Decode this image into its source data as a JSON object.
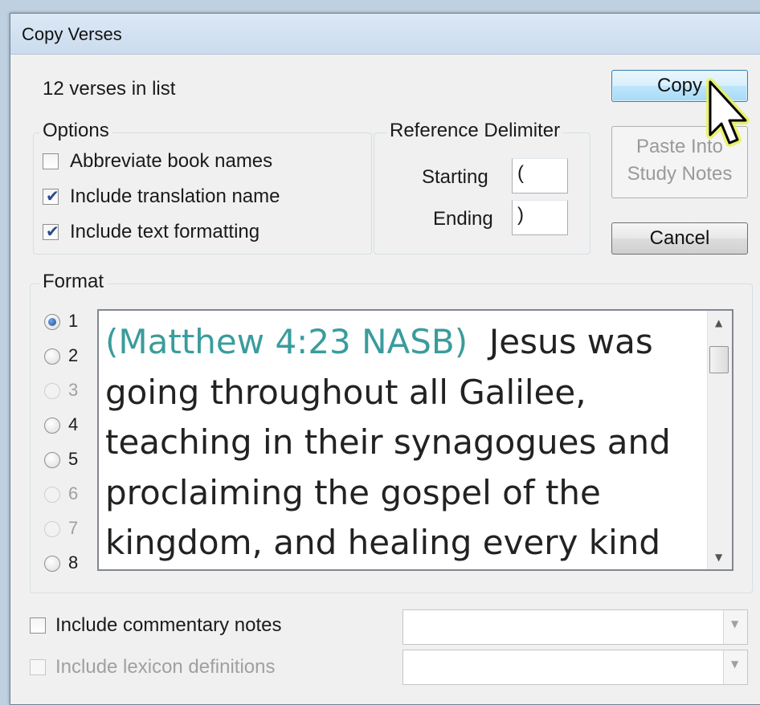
{
  "window": {
    "title": "Copy Verses"
  },
  "summary": "12 verses in list",
  "options": {
    "title": "Options",
    "abbreviate": {
      "label": "Abbreviate book names",
      "checked": false
    },
    "translation": {
      "label": "Include translation name",
      "checked": true
    },
    "formatting": {
      "label": "Include text formatting",
      "checked": true
    }
  },
  "delimiter": {
    "title": "Reference Delimiter",
    "starting_label": "Starting",
    "starting_value": "(",
    "ending_label": "Ending",
    "ending_value": ")"
  },
  "buttons": {
    "copy": "Copy",
    "paste_line1": "Paste Into",
    "paste_line2": "Study Notes",
    "cancel": "Cancel"
  },
  "format": {
    "title": "Format",
    "selected": "1",
    "options": [
      "1",
      "2",
      "3",
      "4",
      "5",
      "6",
      "7",
      "8"
    ],
    "disabled": [
      "3",
      "6",
      "7"
    ]
  },
  "preview": {
    "reference": "(Matthew 4:23 NASB)",
    "text": "Jesus was going throughout all Galilee, teaching in their synagogues and proclaiming the gospel of the kingdom, and healing every kind of",
    "reference_color": "#3a9c9c"
  },
  "extras": {
    "commentary": {
      "label": "Include commentary notes",
      "checked": false,
      "enabled": true
    },
    "lexicon": {
      "label": "Include lexicon definitions",
      "checked": false,
      "enabled": false
    }
  },
  "icons": {
    "checkmark": "check-icon",
    "scroll_up": "scroll-up-arrow-icon",
    "scroll_down": "scroll-down-arrow-icon",
    "combo_dropdown": "chevron-down-icon",
    "mouse_cursor": "mouse-pointer-icon"
  }
}
